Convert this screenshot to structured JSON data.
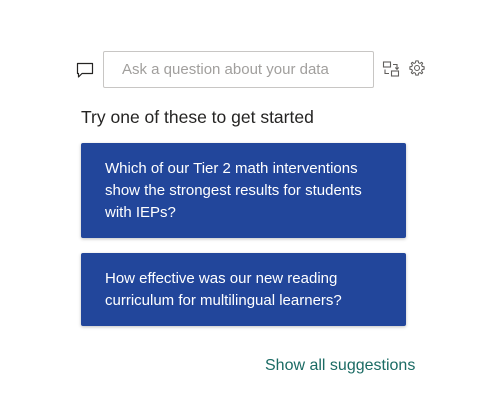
{
  "icons": {
    "chat": "chat-bubble-icon",
    "convert": "convert-to-visual-icon",
    "settings": "gear-icon"
  },
  "search": {
    "placeholder": "Ask a question about your data",
    "value": ""
  },
  "suggestions_heading": "Try one of these to get started",
  "suggestions": [
    {
      "text": "Which of our Tier 2 math interventions show the strongest results for students with IEPs?"
    },
    {
      "text": "How effective was our new reading curriculum for multilingual learners?"
    }
  ],
  "show_all_label": "Show all suggestions",
  "colors": {
    "suggestion_bg": "#22469b",
    "link": "#1b6b64",
    "input_border": "#c8c6c4"
  }
}
